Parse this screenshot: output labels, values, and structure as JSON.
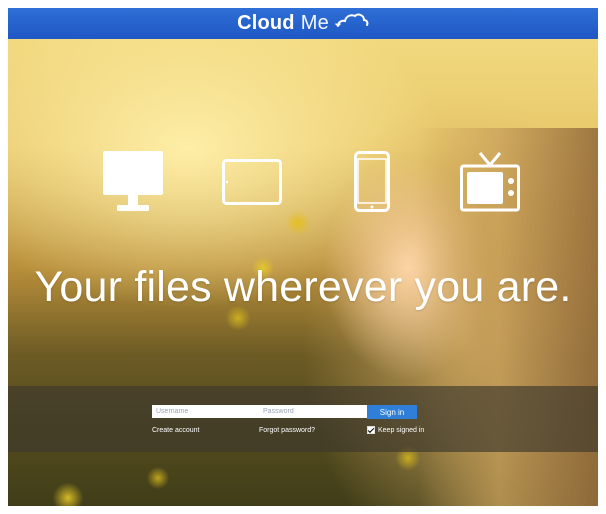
{
  "header": {
    "brand_bold": "Cloud",
    "brand_light": "Me",
    "logo_icon": "cloud-icon",
    "accent_color": "#1f57c4"
  },
  "devices": [
    {
      "icon": "monitor-icon"
    },
    {
      "icon": "tablet-icon"
    },
    {
      "icon": "smartphone-icon"
    },
    {
      "icon": "tv-icon"
    }
  ],
  "tagline": "Your files wherever you are.",
  "login": {
    "username_placeholder": "Username",
    "username_value": "",
    "password_placeholder": "Password",
    "password_value": "",
    "signin_label": "Sign in",
    "create_account_label": "Create account",
    "forgot_password_label": "Forgot password?",
    "keep_signed_in_label": "Keep signed in",
    "keep_signed_in_checked": true,
    "signin_color": "#2f7fd9"
  }
}
